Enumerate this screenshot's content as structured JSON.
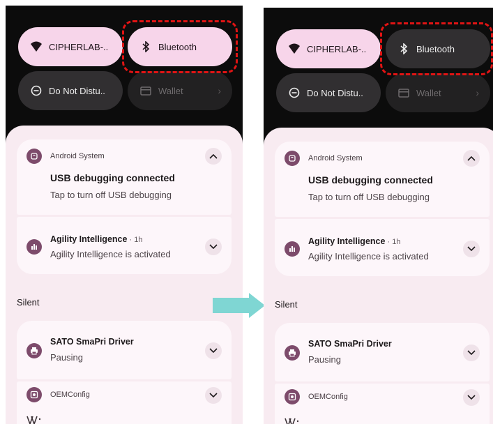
{
  "quick_tiles": {
    "wifi": {
      "label": "CIPHERLAB-..",
      "icon": "wifi-icon"
    },
    "bluetooth": {
      "label": "Bluetooth",
      "icon": "bluetooth-icon"
    },
    "dnd": {
      "label": "Do Not Distu..",
      "icon": "do-not-disturb-icon"
    },
    "wallet": {
      "label": "Wallet",
      "icon": "wallet-icon"
    }
  },
  "notifications": {
    "android_system": {
      "app": "Android System",
      "title": "USB debugging connected",
      "text": "Tap to turn off USB debugging"
    },
    "agility": {
      "title": "Agility Intelligence",
      "time": " · 1h",
      "text": "Agility Intelligence is activated"
    },
    "silent_header": "Silent",
    "sato": {
      "title": "SATO SmaPri Driver",
      "text": "Pausing"
    },
    "oemconfig": {
      "app": "OEMConfig"
    }
  },
  "states": {
    "before": {
      "bluetooth": "on"
    },
    "after": {
      "bluetooth": "off"
    }
  },
  "colors": {
    "tile_on": "#f7d5ea",
    "tile_off": "#312f31",
    "highlight": "#e01414",
    "arrow": "#7fd6d3",
    "app_icon": "#7d4b6b"
  }
}
